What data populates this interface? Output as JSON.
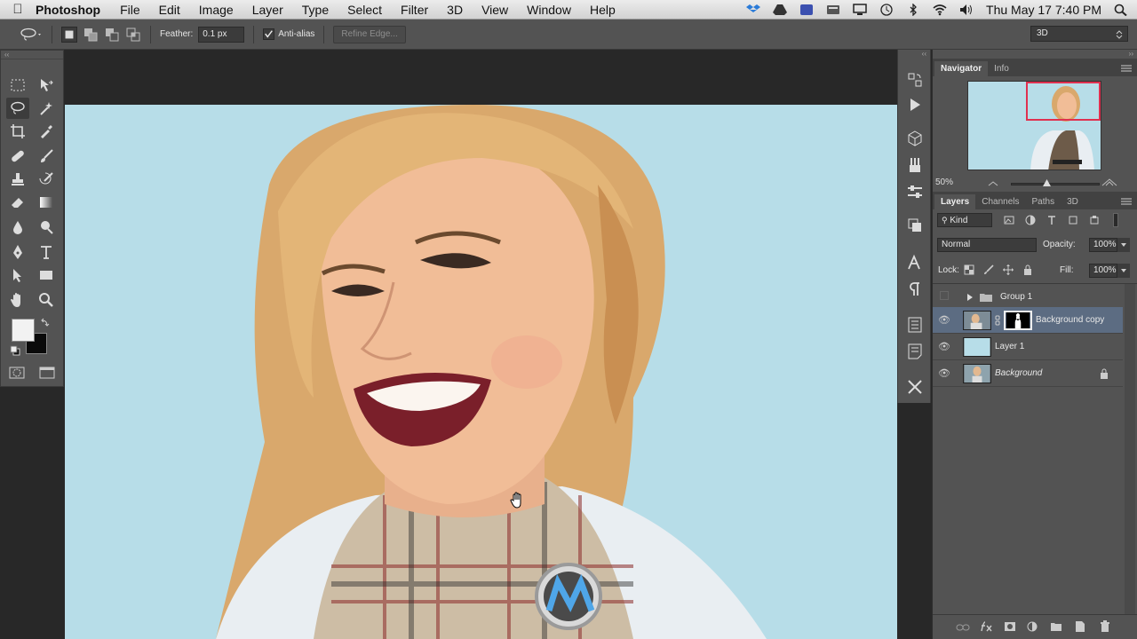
{
  "menubar": {
    "app_name": "Photoshop",
    "items": [
      "File",
      "Edit",
      "Image",
      "Layer",
      "Type",
      "Select",
      "Filter",
      "3D",
      "View",
      "Window",
      "Help"
    ],
    "clock": "Thu May 17  7:40 PM"
  },
  "options_bar": {
    "feather_label": "Feather:",
    "feather_value": "0.1 px",
    "antialias_label": "Anti-alias",
    "refine_label": "Refine Edge...",
    "workspace": "3D"
  },
  "navigator": {
    "tabs": [
      "Navigator",
      "Info"
    ],
    "zoom": "50%"
  },
  "layers_panel": {
    "tabs": [
      "Layers",
      "Channels",
      "Paths",
      "3D"
    ],
    "kind_label": "Kind",
    "blend_mode": "Normal",
    "opacity_label": "Opacity:",
    "opacity_value": "100%",
    "lock_label": "Lock:",
    "fill_label": "Fill:",
    "fill_value": "100%",
    "layers": [
      {
        "name": "Group 1"
      },
      {
        "name": "Background copy"
      },
      {
        "name": "Layer 1"
      },
      {
        "name": "Background"
      }
    ]
  },
  "colors": {
    "canvas_bg": "#b7dde8",
    "selected_layer": "#5c6c82",
    "navigator_box": "#e0304f"
  }
}
